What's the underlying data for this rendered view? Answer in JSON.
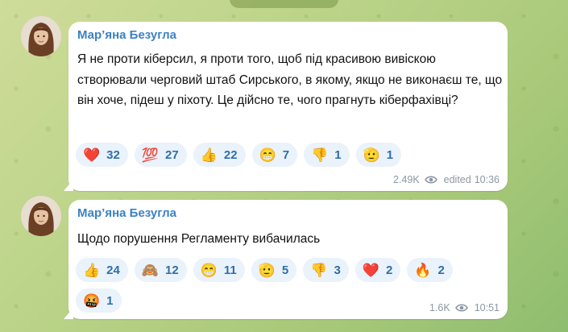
{
  "date_pill": "",
  "messages": [
    {
      "sender": "Мар’яна Безугла",
      "text": "Я не проти кіберсил, я проти того, щоб під красивою вивіскою створювали черговий штаб Сирського, в якому, якщо не виконаєш те, що він хоче, підеш у піхоту. Це дійсно те, чого прагнуть кіберфахівці?",
      "reactions": [
        {
          "emoji": "❤️",
          "icon": "heart-icon",
          "count": "32"
        },
        {
          "emoji": "💯",
          "icon": "hundred-icon",
          "count": "27"
        },
        {
          "emoji": "👍",
          "icon": "thumbs-up-icon",
          "count": "22"
        },
        {
          "emoji": "😁",
          "icon": "grin-icon",
          "count": "7"
        },
        {
          "emoji": "👎",
          "icon": "thumbs-down-icon",
          "count": "1"
        },
        {
          "emoji": "🫡",
          "icon": "salute-icon",
          "count": "1"
        }
      ],
      "views": "2.49K",
      "edited": "edited",
      "time": "10:36"
    },
    {
      "sender": "Мар’яна Безугла",
      "text": "Щодо порушення Регламенту вибачилась",
      "reactions": [
        {
          "emoji": "👍",
          "icon": "thumbs-up-icon",
          "count": "24"
        },
        {
          "emoji": "🙈",
          "icon": "see-no-evil-monkey-icon",
          "count": "12"
        },
        {
          "emoji": "😁",
          "icon": "grin-icon",
          "count": "11"
        },
        {
          "emoji": "🫡",
          "icon": "salute-icon",
          "count": "5"
        },
        {
          "emoji": "👎",
          "icon": "thumbs-down-icon",
          "count": "3"
        },
        {
          "emoji": "❤️",
          "icon": "heart-icon",
          "count": "2"
        },
        {
          "emoji": "🔥",
          "icon": "fire-icon",
          "count": "2"
        },
        {
          "emoji": "🤬",
          "icon": "cursing-face-icon",
          "count": "1"
        }
      ],
      "views": "1.6K",
      "time": "10:51"
    }
  ]
}
